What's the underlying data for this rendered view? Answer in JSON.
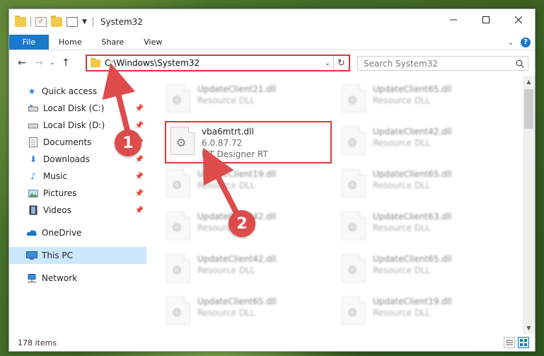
{
  "window": {
    "title": "System32"
  },
  "ribbon": {
    "tabs": [
      "File",
      "Home",
      "Share",
      "View"
    ]
  },
  "address": {
    "path": "C:\\Windows\\System32"
  },
  "search": {
    "placeholder": "Search System32"
  },
  "sidebar": {
    "items": [
      {
        "label": "Quick access",
        "icon": "star-icon",
        "pinned": false
      },
      {
        "label": "Local Disk (C:)",
        "icon": "drive-icon",
        "pinned": true
      },
      {
        "label": "Local Disk (D:)",
        "icon": "drive-icon",
        "pinned": true
      },
      {
        "label": "Documents",
        "icon": "documents-icon",
        "pinned": true
      },
      {
        "label": "Downloads",
        "icon": "download-icon",
        "pinned": true
      },
      {
        "label": "Music",
        "icon": "music-icon",
        "pinned": true
      },
      {
        "label": "Pictures",
        "icon": "pictures-icon",
        "pinned": true
      },
      {
        "label": "Videos",
        "icon": "videos-icon",
        "pinned": true
      },
      {
        "label": "OneDrive",
        "icon": "cloud-icon"
      },
      {
        "label": "This PC",
        "icon": "computer-icon",
        "selected": true
      },
      {
        "label": "Network",
        "icon": "network-icon"
      }
    ]
  },
  "files": [
    {
      "name": "UpdateClient21.dll",
      "line2": "Resource DLL",
      "line3": ""
    },
    {
      "name": "UpdateClient65.dll",
      "line2": "Resource DLL",
      "line3": ""
    },
    {
      "name": "vba6mtrt.dll",
      "line2": "6.0.87.72",
      "line3": "MT Designer RT",
      "highlighted": true
    },
    {
      "name": "UpdateClient42.dll",
      "line2": "Resource DLL",
      "line3": ""
    },
    {
      "name": "UpdateClient19.dll",
      "line2": "Resource DLL",
      "line3": ""
    },
    {
      "name": "UpdateClient65.dll",
      "line2": "Resource DLL",
      "line3": ""
    },
    {
      "name": "UpdateClient42.dll",
      "line2": "Resource DLL",
      "line3": ""
    },
    {
      "name": "UpdateClient63.dll",
      "line2": "Resource DLL",
      "line3": ""
    },
    {
      "name": "UpdateClient42.dll",
      "line2": "Resource DLL",
      "line3": ""
    },
    {
      "name": "UpdateClient65.dll",
      "line2": "Resource DLL",
      "line3": ""
    },
    {
      "name": "UpdateClient65.dll",
      "line2": "Resource DLL",
      "line3": ""
    },
    {
      "name": "UpdateClient19.dll",
      "line2": "Resource DLL",
      "line3": ""
    }
  ],
  "status": {
    "item_count": "178 items"
  },
  "callouts": {
    "step1": "1",
    "step2": "2"
  },
  "colors": {
    "accent": "#1979ca",
    "highlight": "#d63a3a",
    "badge": "#dd4b4b",
    "selected": "#cce8ff"
  }
}
